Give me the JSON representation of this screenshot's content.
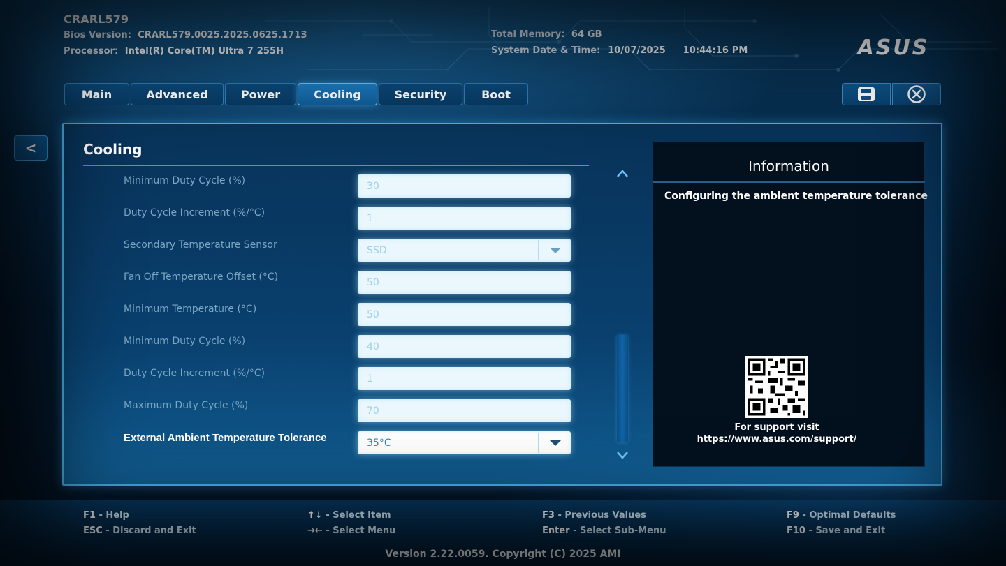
{
  "header": {
    "system_name": "CRARL579",
    "bios_version_label": "Bios Version:",
    "bios_version": "CRARL579.0025.2025.0625.1713",
    "processor_label": "Processor:",
    "processor": "Intel(R) Core(TM) Ultra 7 255H",
    "memory_label": "Total Memory:",
    "memory": "64 GB",
    "datetime_label": "System Date & Time:",
    "date": "10/07/2025",
    "time": "10:44:16 PM",
    "brand": "ASUS"
  },
  "tabs": [
    {
      "label": "Main"
    },
    {
      "label": "Advanced"
    },
    {
      "label": "Power"
    },
    {
      "label": "Cooling",
      "active": true
    },
    {
      "label": "Security"
    },
    {
      "label": "Boot"
    }
  ],
  "toolbar": {
    "save_icon": "floppy-disk-icon",
    "exit_icon": "close-circle-icon"
  },
  "nav": {
    "back_label": "<"
  },
  "page": {
    "title": "Cooling",
    "settings": [
      {
        "label": "Minimum Duty Cycle (%)",
        "value": "30",
        "type": "input"
      },
      {
        "label": "Duty Cycle Increment (%/°C)",
        "value": "1",
        "type": "input"
      },
      {
        "label": "Secondary Temperature Sensor",
        "value": "SSD",
        "type": "dropdown"
      },
      {
        "label": "Fan Off Temperature Offset (°C)",
        "value": "50",
        "type": "input"
      },
      {
        "label": "Minimum Temperature (°C)",
        "value": "50",
        "type": "input"
      },
      {
        "label": "Minimum Duty Cycle (%)",
        "value": "40",
        "type": "input"
      },
      {
        "label": "Duty Cycle Increment (%/°C)",
        "value": "1",
        "type": "input"
      },
      {
        "label": "Maximum Duty Cycle (%)",
        "value": "70",
        "type": "input"
      },
      {
        "label": "External Ambient Temperature Tolerance",
        "value": "35°C",
        "type": "dropdown",
        "selected": true
      }
    ]
  },
  "info": {
    "title": "Information",
    "description": "Configuring the ambient temperature tolerance",
    "support_line1": "For support visit",
    "support_line2": "https://www.asus.com/support/"
  },
  "footer": {
    "keys": [
      {
        "key": "F1",
        "desc": "Help"
      },
      {
        "key": "ESC",
        "desc": "Discard and Exit"
      },
      {
        "key": "↑↓",
        "desc": "Select Item"
      },
      {
        "key": "→←",
        "desc": "Select Menu"
      },
      {
        "key": "F3",
        "desc": "Previous Values"
      },
      {
        "key": "Enter",
        "desc": "Select Sub-Menu"
      },
      {
        "key": "F9",
        "desc": "Optimal Defaults"
      },
      {
        "key": "F10",
        "desc": "Save and Exit"
      }
    ],
    "version": "Version 2.22.0059. Copyright (C) 2025 AMI"
  },
  "colors": {
    "accent": "#1c7fc4",
    "panel_border": "#4aaee8",
    "info_bg": "#03111f"
  }
}
